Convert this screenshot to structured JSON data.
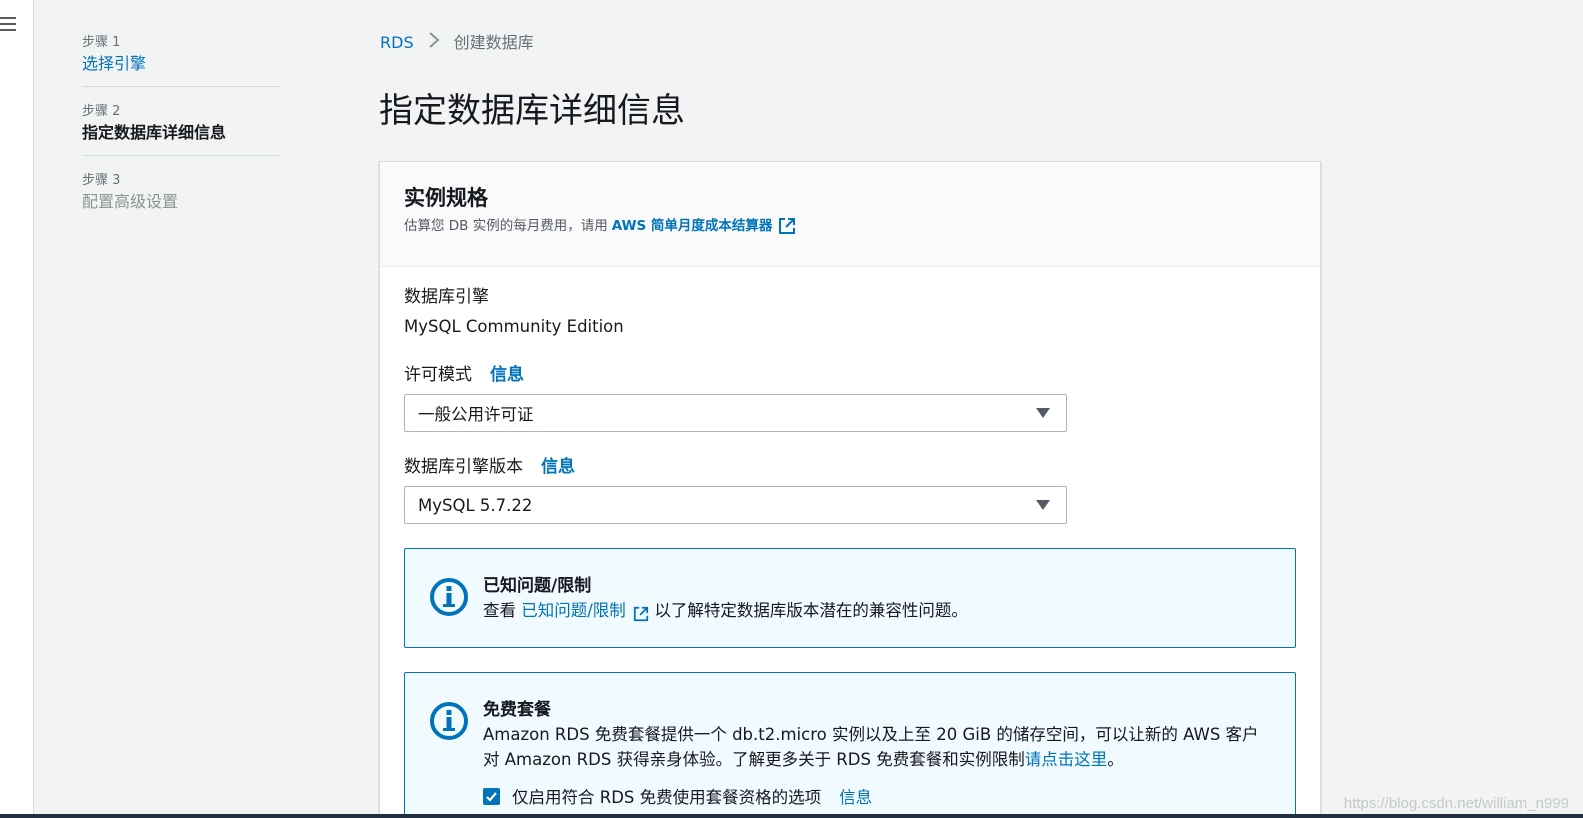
{
  "steps": [
    {
      "num": "步骤 1",
      "title": "选择引擎",
      "state": "link"
    },
    {
      "num": "步骤 2",
      "title": "指定数据库详细信息",
      "state": "active"
    },
    {
      "num": "步骤 3",
      "title": "配置高级设置",
      "state": "disabled"
    }
  ],
  "breadcrumb": {
    "root": "RDS",
    "separator": ">",
    "current": "创建数据库"
  },
  "page_title": "指定数据库详细信息",
  "panel": {
    "title": "实例规格",
    "desc_prefix": "估算您 DB 实例的每月费用，请用",
    "desc_link": "AWS 简单月度成本结算器"
  },
  "engine": {
    "label": "数据库引擎",
    "value": "MySQL Community Edition"
  },
  "license": {
    "label": "许可模式",
    "info": "信息",
    "selected": "一般公用许可证"
  },
  "version": {
    "label": "数据库引擎版本",
    "info": "信息",
    "selected": "MySQL 5.7.22"
  },
  "known_issues": {
    "title": "已知问题/限制",
    "text_prefix": "查看",
    "link": "已知问题/限制",
    "text_suffix": "以了解特定数据库版本潜在的兼容性问题。"
  },
  "free_tier": {
    "title": "免费套餐",
    "line1": "Amazon RDS 免费套餐提供一个 db.t2.micro 实例以及上至 20 GiB 的储存空间，可以让新的 AWS 客户",
    "line2_prefix": "对 Amazon RDS 获得亲身体验。了解更多关于 RDS 免费套餐和实例限制",
    "line2_link": "请点击这里",
    "line2_suffix": "。",
    "checkbox_label": "仅启用符合 RDS 免费使用套餐资格的选项",
    "checkbox_checked": true,
    "info": "信息"
  },
  "watermark": "https://blog.csdn.net/william_n999",
  "colors": {
    "link": "#0073bb",
    "background": "#f2f3f3",
    "alert_bg": "#f1faff",
    "text": "#16191f"
  }
}
